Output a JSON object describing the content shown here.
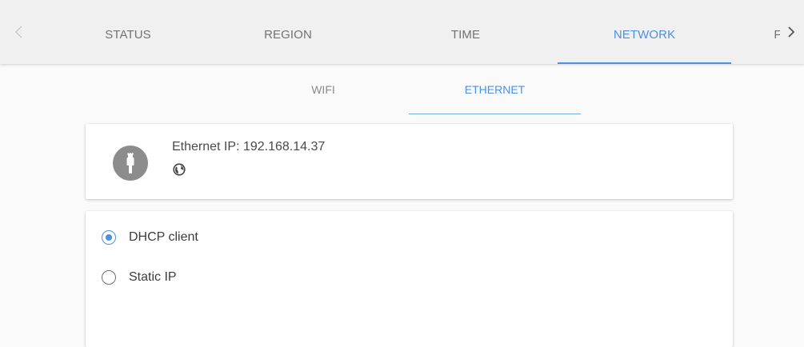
{
  "topbar": {
    "tabs": [
      {
        "label": "STATUS",
        "active": false
      },
      {
        "label": "REGION",
        "active": false
      },
      {
        "label": "TIME",
        "active": false
      },
      {
        "label": "NETWORK",
        "active": true
      },
      {
        "label": "F",
        "active": false
      }
    ],
    "prev_icon": "chevron-left-icon",
    "next_icon": "chevron-right-icon"
  },
  "subtabs": [
    {
      "label": "WIFI",
      "active": false
    },
    {
      "label": "ETHERNET",
      "active": true
    }
  ],
  "ethernet_card": {
    "icon": "ethernet-plug-icon",
    "ip_text": "Ethernet IP: 192.168.14.37",
    "status_icon": "globe-icon"
  },
  "ip_mode": {
    "options": [
      {
        "label": "DHCP client",
        "checked": true
      },
      {
        "label": "Static IP",
        "checked": false
      }
    ]
  },
  "colors": {
    "accent": "#4f8fe0",
    "tabbar_bg": "#f0f0f0",
    "avatar_bg": "#8c8c8c"
  }
}
